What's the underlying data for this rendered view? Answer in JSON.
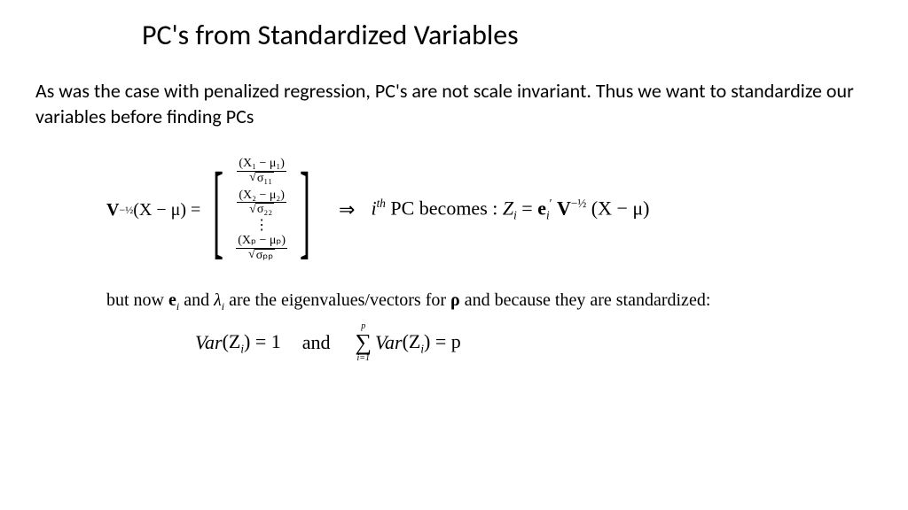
{
  "title": "PC's from Standardized Variables",
  "body": "As was the case with penalized regression, PC's are not scale invariant.  Thus we want to standardize our variables before finding PCs",
  "math": {
    "lhs_pre": "V",
    "lhs_exp": "−½",
    "lhs_paren": "(X − μ) =",
    "vec_e1_num": "(X₁ − μ₁)",
    "vec_e1_den_inner": "σ₁₁",
    "vec_e2_num": "(X₂ − μ₂)",
    "vec_e2_den_inner": "σ₂₂",
    "vec_ep_num": "(Xₚ − μₚ)",
    "vec_ep_den_inner": "σₚₚ",
    "vdots": "⋮",
    "arrow": "⇒",
    "ith": "i",
    "th": "th",
    "becomes": " PC becomes :   ",
    "z": "Z",
    "eq": " = ",
    "e": "e",
    "prime": "′",
    "V": "V",
    "vexp": "−½",
    "xmu": "(X − μ)"
  },
  "note_pre": "but now ",
  "note_e": "e",
  "note_and1": " and ",
  "note_lambda": "λ",
  "note_rest": " are the eigenvalues/vectors for ",
  "note_rho": "ρ",
  "note_tail": " and because they are standardized:",
  "var": {
    "var1": "Var",
    "z1": "(Z",
    "close1": ") = 1",
    "and": "and",
    "sum_top": "p",
    "sum_bot": "i=1",
    "var2": "Var",
    "z2": "(Z",
    "close2": ") = p"
  },
  "sub_i": "i"
}
